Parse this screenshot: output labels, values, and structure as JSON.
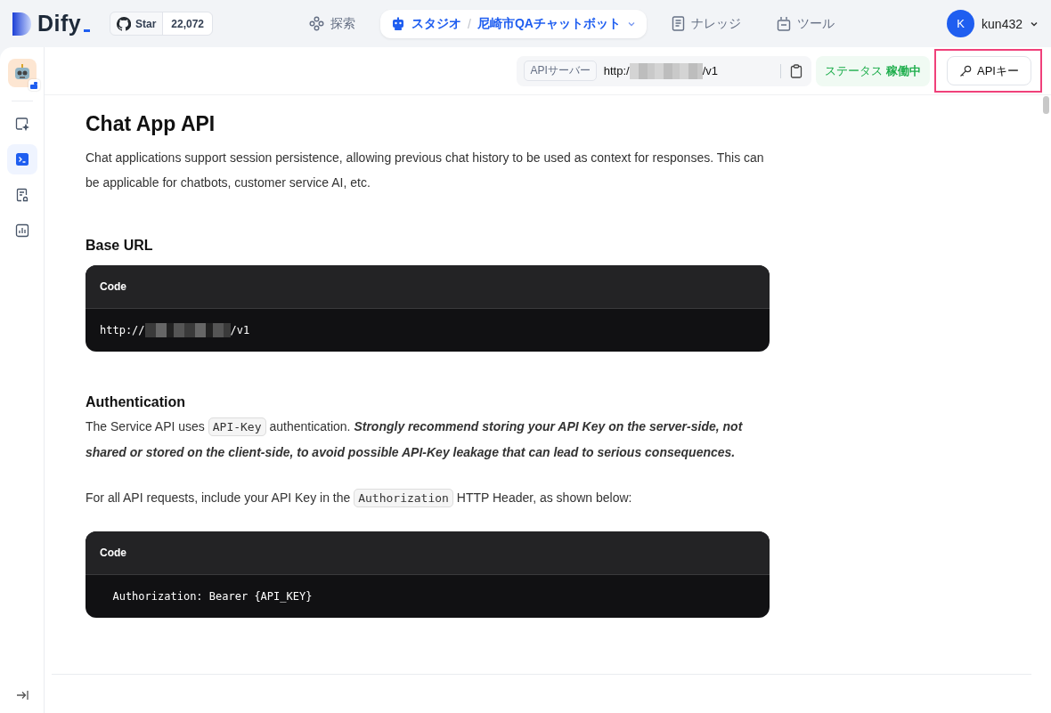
{
  "nav": {
    "logo": "Dify",
    "star_label": "Star",
    "star_count": "22,072",
    "items": [
      {
        "kind": "explore",
        "label": "探索",
        "selected": false
      },
      {
        "kind": "studio",
        "label": "スタジオ",
        "separator": "/",
        "app_name": "尼崎市QAチャットボット",
        "selected": true
      },
      {
        "kind": "knowledge",
        "label": "ナレッジ",
        "selected": false
      },
      {
        "kind": "tools",
        "label": "ツール",
        "selected": false
      }
    ],
    "user": {
      "initial": "K",
      "name": "kun432"
    }
  },
  "sidebar": {
    "items": [
      {
        "kind": "orchestrate",
        "selected": false
      },
      {
        "kind": "api",
        "selected": true
      },
      {
        "kind": "logs",
        "selected": false
      },
      {
        "kind": "monitoring",
        "selected": false
      }
    ]
  },
  "header": {
    "server_label": "APIサーバー",
    "url_prefix": "http:/",
    "url_suffix": "/v1",
    "status_label": "ステータス",
    "status_value": "稼働中",
    "api_key_button": "APIキー",
    "highlighted": true
  },
  "doc": {
    "title": "Chat App API",
    "intro": "Chat applications support session persistence, allowing previous chat history to be used as context for responses. This can be applicable for chatbots, customer service AI, etc.",
    "sections": [
      {
        "heading": "Base URL",
        "blocks": [
          {
            "kind": "code",
            "label": "Code",
            "parts": [
              {
                "kind": "text",
                "text": "http://"
              },
              {
                "kind": "redacted"
              },
              {
                "kind": "text",
                "text": "/v1"
              }
            ]
          }
        ]
      },
      {
        "heading": "Authentication",
        "blocks": [
          {
            "kind": "paragraph",
            "parts": [
              {
                "kind": "text",
                "text": "The Service API uses "
              },
              {
                "kind": "code",
                "text": "API-Key"
              },
              {
                "kind": "text",
                "text": " authentication. "
              },
              {
                "kind": "emphasis",
                "text": "Strongly recommend storing your API Key on the server-side, not shared or stored on the client-side, to avoid possible API-Key leakage that can lead to serious consequences."
              }
            ]
          },
          {
            "kind": "paragraph",
            "parts": [
              {
                "kind": "text",
                "text": "For all API requests, include your API Key in the "
              },
              {
                "kind": "code",
                "text": "Authorization"
              },
              {
                "kind": "text",
                "text": " HTTP Header, as shown below:"
              }
            ]
          },
          {
            "kind": "code",
            "label": "Code",
            "parts": [
              {
                "kind": "text",
                "text": "  Authorization: Bearer {API_KEY}"
              }
            ]
          }
        ]
      }
    ]
  }
}
